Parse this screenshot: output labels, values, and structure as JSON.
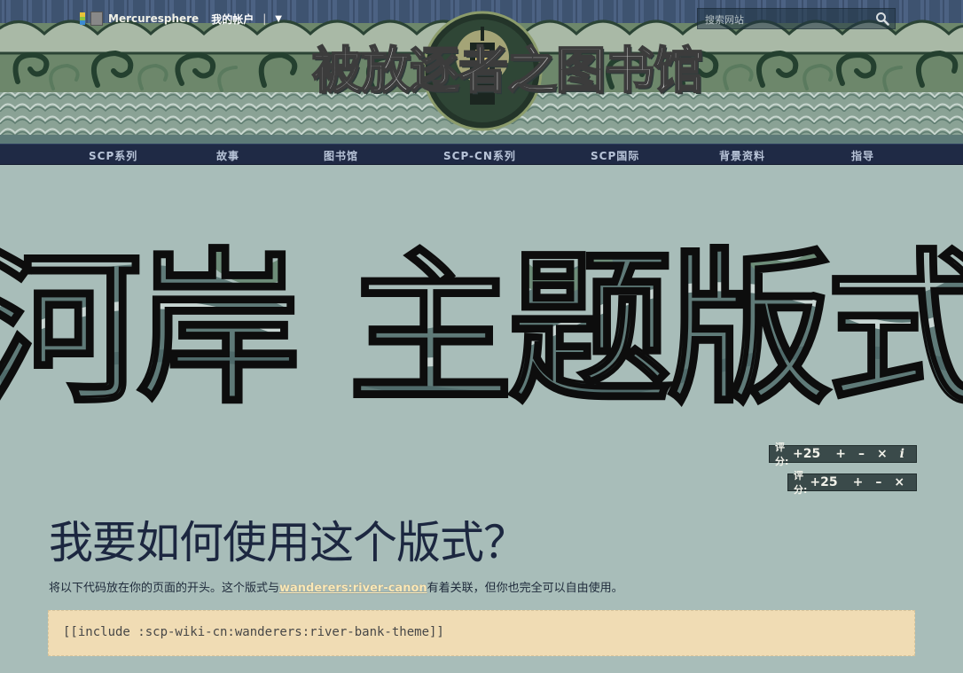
{
  "header": {
    "username": "Mercuresphere",
    "account_label": "我的帐户",
    "account_separator": "|",
    "account_toggle": "▼",
    "search_placeholder": "搜索网站",
    "site_title": "被放逐者之图书馆",
    "colors": {
      "waves_dark": "#2f4a3c",
      "waves_light": "#a7b8a9",
      "nav_bg": "#1f2a45"
    }
  },
  "nav": {
    "items": [
      "SCP系列",
      "故事",
      "图书馆",
      "SCP-CN系列",
      "SCP国际",
      "背景资料",
      "指导"
    ]
  },
  "page": {
    "title": "河岸 主题版式"
  },
  "rating": {
    "label": "评分:",
    "value": "+25",
    "up": "+",
    "down": "–",
    "cancel": "×",
    "info": "i"
  },
  "content": {
    "heading": "我要如何使用这个版式？",
    "paragraph_before": "将以下代码放在你的页面的开头。这个版式与",
    "link_text": "wanderers:river-canon",
    "paragraph_after": "有着关联，但你也完全可以自由使用。",
    "code": "[[include :scp-wiki-cn:wanderers:river-bank-theme]]"
  }
}
